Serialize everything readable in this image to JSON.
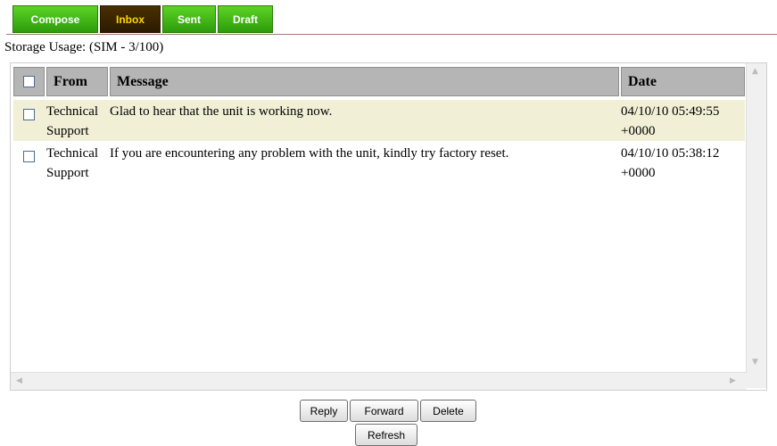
{
  "tabs": [
    {
      "label": "Compose",
      "active": false
    },
    {
      "label": "Inbox",
      "active": true
    },
    {
      "label": "Sent",
      "active": false
    },
    {
      "label": "Draft",
      "active": false
    }
  ],
  "storage": {
    "text": "Storage Usage: (SIM - 3/100)"
  },
  "table": {
    "headers": {
      "from": "From",
      "message": "Message",
      "date": "Date"
    },
    "rows": [
      {
        "from_line1": "Technical",
        "from_line2": "Support",
        "message": "Glad to hear that the unit is working now.",
        "date_line1": "04/10/10 05:49:55",
        "date_line2": "+0000",
        "checked": false
      },
      {
        "from_line1": "Technical",
        "from_line2": "Support",
        "message": "If you are encountering any problem with the unit, kindly try factory reset.",
        "date_line1": "04/10/10 05:38:12",
        "date_line2": "+0000",
        "checked": false
      }
    ]
  },
  "buttons": {
    "reply": "Reply",
    "forward": "Forward",
    "delete": "Delete",
    "refresh": "Refresh"
  },
  "colors": {
    "tab_green": "#3cb516",
    "tab_active_bg": "#3a2400",
    "tab_active_text": "#ffd800",
    "row_highlight": "#f1f0d6",
    "header_bg": "#b5b5b5"
  }
}
